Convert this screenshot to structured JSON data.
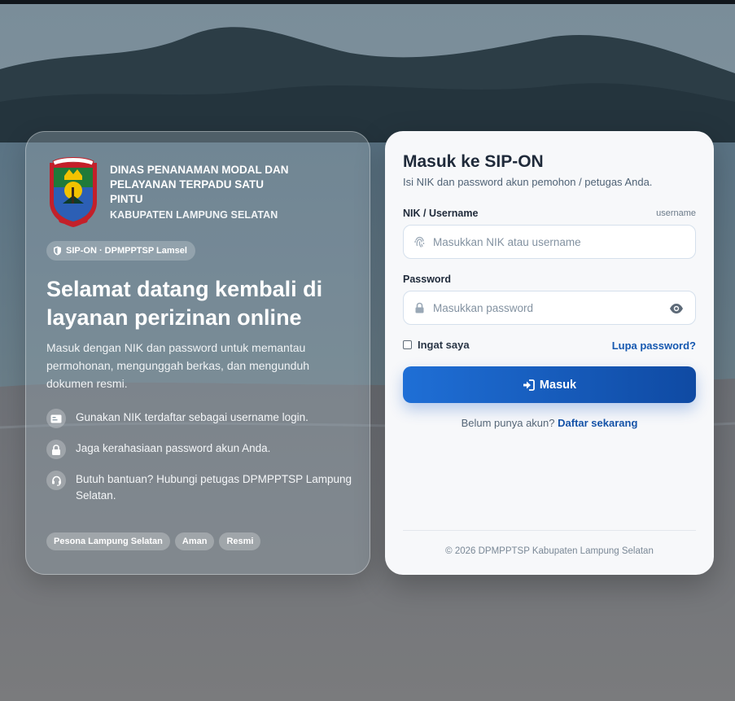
{
  "left": {
    "org_name": "DINAS PENANAMAN MODAL DAN PELAYANAN TERPADU SATU PINTU",
    "org_region": "KABUPATEN LAMPUNG SELATAN",
    "badge": "SIP-ON · DPMPPTSP Lamsel",
    "welcome": "Selamat datang kembali di layanan perizinan online",
    "description": "Masuk dengan NIK dan password untuk memantau permohonan, mengunggah berkas, dan mengunduh dokumen resmi.",
    "features": [
      {
        "icon": "id-card-icon",
        "text": "Gunakan NIK terdaftar sebagai username login."
      },
      {
        "icon": "lock-icon",
        "text": "Jaga kerahasiaan password akun Anda."
      },
      {
        "icon": "headset-icon",
        "text": "Butuh bantuan? Hubungi petugas DPMPPTSP Lampung Selatan."
      }
    ],
    "tags": [
      "Pesona Lampung Selatan",
      "Aman",
      "Resmi"
    ]
  },
  "login": {
    "title": "Masuk ke SIP-ON",
    "subtitle": "Isi NIK dan password akun pemohon / petugas Anda.",
    "username_label": "NIK / Username",
    "username_hint": "username",
    "username_placeholder": "Masukkan NIK atau username",
    "password_label": "Password",
    "password_placeholder": "Masukkan password",
    "remember_label": "Ingat saya",
    "forgot_label": "Lupa password?",
    "submit_label": "Masuk",
    "signup_prompt": "Belum punya akun?",
    "signup_link": "Daftar sekarang",
    "copyright": "© 2026 DPMPPTSP Kabupaten Lampung Selatan"
  },
  "colors": {
    "primary": "#1a5fc4",
    "link": "#1558b0"
  }
}
